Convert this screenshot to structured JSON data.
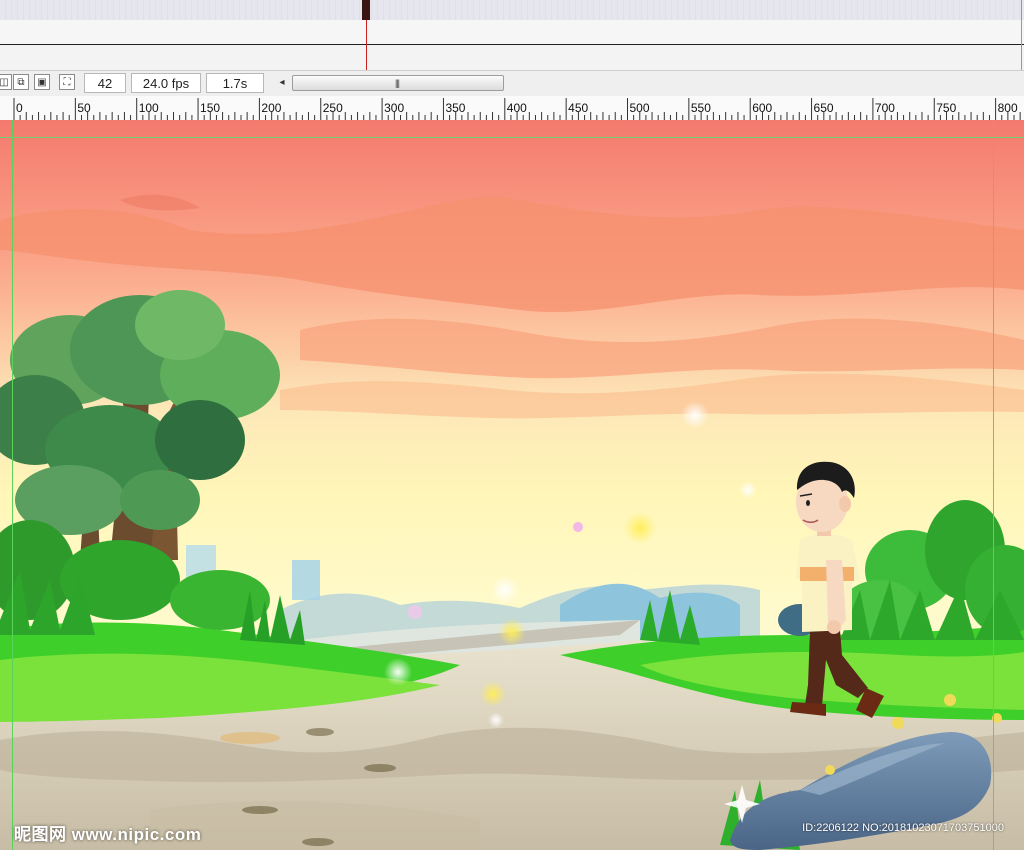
{
  "timeline": {
    "current_frame": "42",
    "frame_rate": "24.0 fps",
    "elapsed_time": "1.7s"
  },
  "status_icons": [
    "center-frame-icon",
    "onion-skin-icon",
    "onion-skin-outlines-icon",
    "edit-multiple-frames-icon"
  ],
  "ruler": {
    "labels": [
      "0",
      "50",
      "100",
      "150",
      "200",
      "250",
      "300",
      "350",
      "400",
      "450",
      "500",
      "550",
      "600",
      "650",
      "700",
      "750",
      "800"
    ]
  },
  "watermark": {
    "site": "昵图网 www.nipic.com",
    "id_line": "ID:2206122 NO:20181023071703751000"
  },
  "colors": {
    "guide": "#5ad35a",
    "playhead": "#cc2020",
    "sky_top": "#f47a6e",
    "sky_bottom": "#fff4b0",
    "grass": "#3fcf2a"
  }
}
